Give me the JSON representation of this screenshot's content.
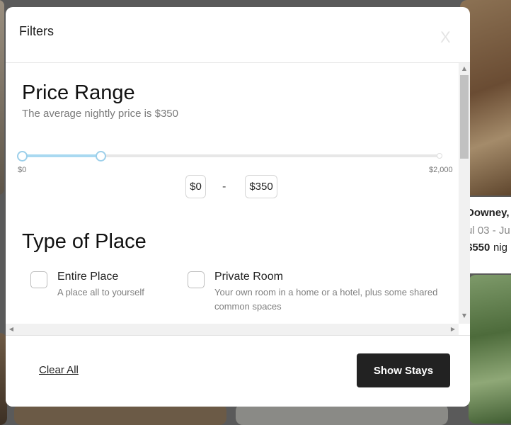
{
  "modal": {
    "title": "Filters",
    "close_label": "X"
  },
  "price_range": {
    "heading": "Price Range",
    "subtitle": "The average nightly price is $350",
    "min_label": "$0",
    "max_label": "$2,000",
    "selected_min": "$0",
    "selected_max": "$350",
    "separator": "-",
    "selected_fraction_low": 0,
    "selected_fraction_high": 0.175
  },
  "type_of_place": {
    "heading": "Type of Place",
    "options": [
      {
        "title": "Entire Place",
        "description": "A place all to yourself"
      },
      {
        "title": "Private Room",
        "description": "Your own room in a home or a hotel, plus some shared common spaces"
      }
    ]
  },
  "footer": {
    "clear_label": "Clear All",
    "show_label": "Show Stays"
  },
  "background_card": {
    "location": "Downey,",
    "dates": "ul 03 - Ju",
    "price": "$550",
    "price_unit": "nig"
  },
  "colors": {
    "slider_fill": "#a9d9f1",
    "button_bg": "#222222"
  }
}
